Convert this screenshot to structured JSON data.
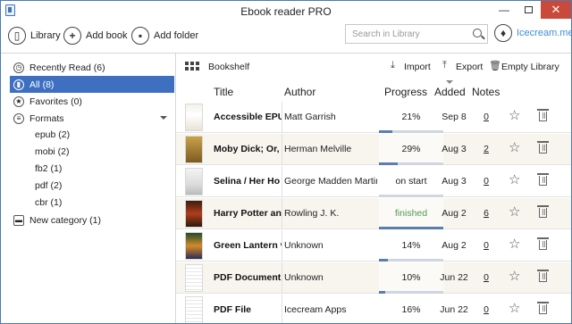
{
  "window": {
    "title": "Ebook reader PRO"
  },
  "toolbar": {
    "library_label": "Library",
    "add_book_label": "Add book",
    "add_folder_label": "Add folder",
    "search_placeholder": "Search in Library",
    "brand_label": "Icecream.me"
  },
  "sidebar": {
    "items": [
      {
        "label": "Recently Read (6)",
        "icon": "clock-icon"
      },
      {
        "label": "All (8)",
        "icon": "book-icon",
        "active": true
      },
      {
        "label": "Favorites (0)",
        "icon": "star-icon"
      },
      {
        "label": "Formats",
        "icon": "format-icon"
      },
      {
        "label": "epub (2)"
      },
      {
        "label": "mobi (2)"
      },
      {
        "label": "fb2 (1)"
      },
      {
        "label": "pdf (2)"
      },
      {
        "label": "cbr (1)"
      },
      {
        "label": "New category (1)",
        "icon": "folder-icon"
      }
    ]
  },
  "main": {
    "view_label": "Bookshelf",
    "import_label": "Import",
    "export_label": "Export",
    "empty_label": "Empty Library"
  },
  "table": {
    "columns": [
      "Title",
      "Author",
      "Progress",
      "Added",
      "Notes"
    ],
    "rows": [
      {
        "title": "Accessible EPUB",
        "author": "Matt Garrish",
        "progress": "21%",
        "progress_value": 0.21,
        "added": "Sep 8",
        "notes": "0"
      },
      {
        "title": "Moby Dick; Or,",
        "author": "Herman Melville",
        "progress": "29%",
        "progress_value": 0.29,
        "added": "Aug 3",
        "notes": "2"
      },
      {
        "title": "Selina / Her Ho",
        "author": "George Madden Martin",
        "progress": "on start",
        "progress_value": 0.0,
        "added": "Aug 3",
        "notes": "0"
      },
      {
        "title": "Harry Potter an",
        "author": "Rowling J. K.",
        "progress": "finished",
        "progress_value": 1.0,
        "added": "Aug 2",
        "notes": "6"
      },
      {
        "title": "Green Lantern v",
        "author": "Unknown",
        "progress": "14%",
        "progress_value": 0.14,
        "added": "Aug 2",
        "notes": "0"
      },
      {
        "title": "PDF Document",
        "author": "Unknown",
        "progress": "10%",
        "progress_value": 0.1,
        "added": "Jun 22",
        "notes": "0"
      },
      {
        "title": "PDF File",
        "author": "Icecream Apps",
        "progress": "16%",
        "progress_value": 0.16,
        "added": "Jun 22",
        "notes": "0"
      }
    ]
  },
  "colors": {
    "accent": "#3f6fc0",
    "progress_fill": "#5b7db0",
    "finished": "#4f9a4f",
    "close_button": "#c94a3a",
    "brand": "#3b8fd9"
  }
}
